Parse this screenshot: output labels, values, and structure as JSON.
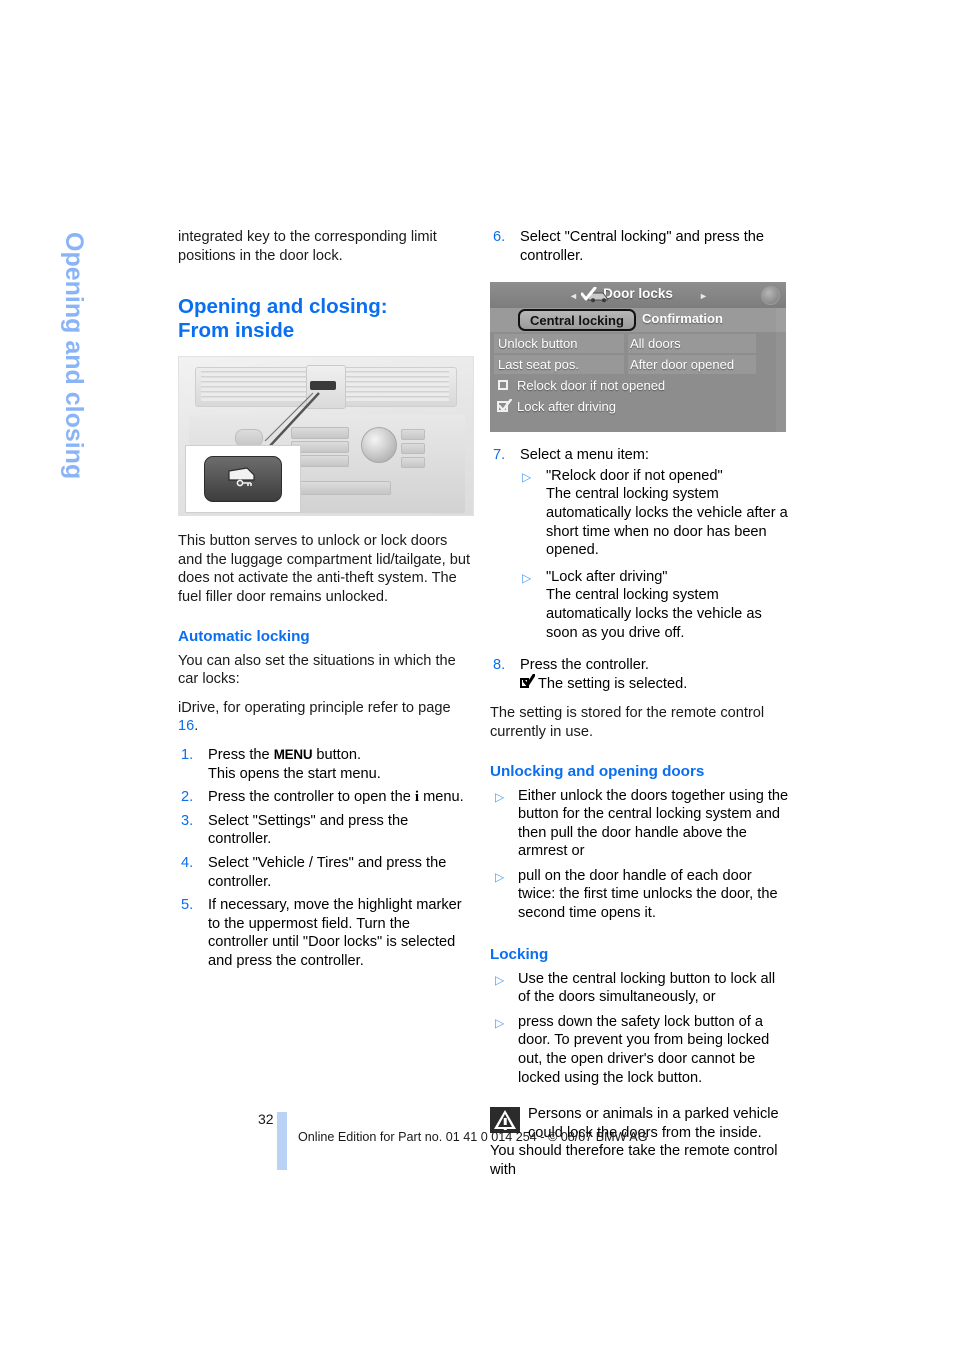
{
  "document": {
    "chapter_tab": "Opening and closing",
    "page_number": "32",
    "footer": "Online Edition for Part no. 01 41 0 014 254 - © 08/07 BMW AG",
    "accent_blue": "#0a6ef0",
    "tab_blue": "#8ab4f8",
    "rule_blue": "#b9d2f5"
  },
  "left_column": {
    "continued_paragraph": "integrated key to the corresponding limit positions in the door lock.",
    "heading": "Opening and closing:\nFrom inside",
    "heading_line1": "Opening and closing:",
    "heading_line2": "From inside",
    "photo_caption_watermark": "",
    "intro_paragraph": "This button serves to unlock or lock doors and the luggage compartment lid/tailgate, but does not activate the anti-theft system. The fuel filler door remains unlocked.",
    "automatic_locking": {
      "heading": "Automatic locking",
      "paragraph": "You can also set the situations in which the car locks:",
      "idrive_note_prefix": "iDrive, for operating principle refer to page ",
      "idrive_note_pageref": "16",
      "idrive_note_suffix": ".",
      "steps": [
        {
          "num": "1.",
          "pre": "Press the ",
          "strong": "MENU",
          "post": " button.",
          "second_line": "This opens the start menu."
        },
        {
          "num": "2.",
          "pre": "Press the controller to open the ",
          "strong": "i",
          "post": " menu.",
          "second_line": ""
        },
        {
          "num": "3.",
          "text": "Select \"Settings\" and press the controller."
        },
        {
          "num": "4.",
          "text": "Select \"Vehicle / Tires\" and press the controller."
        },
        {
          "num": "5.",
          "text": "If necessary, move the highlight marker to the uppermost field. Turn the controller until \"Door locks\" is selected and press the controller."
        }
      ]
    }
  },
  "right_column": {
    "step6": {
      "num": "6.",
      "text": "Select \"Central locking\" and press the controller."
    },
    "idrive_screen": {
      "title": "Door locks",
      "left_arrow": "◄",
      "right_arrow": "►",
      "car_icon": "car-check-icon",
      "corner_icon": "info-badge-icon",
      "tab_selected": "Central locking",
      "tab_unselected": "Confirmation",
      "rows": [
        {
          "label": "Unlock button",
          "value": "All doors"
        },
        {
          "label": "Last seat pos.",
          "value": "After door opened"
        }
      ],
      "checkboxes": [
        {
          "label": "Relock door if not opened",
          "checked": false
        },
        {
          "label": "Lock after driving",
          "checked": true
        }
      ]
    },
    "step7": {
      "num": "7.",
      "text": "Select a menu item:",
      "items": [
        {
          "title": "\"Relock door if not opened\"",
          "body": "The central locking system automatically locks the vehicle after a short time when no door has been opened."
        },
        {
          "title": "\"Lock after driving\"",
          "body": "The central locking system automatically locks the vehicle as soon as you drive off."
        }
      ]
    },
    "step8": {
      "num": "8.",
      "text": "Press the controller.",
      "result": "The setting is selected.",
      "result_icon": "checkbox-checked-icon"
    },
    "stored_paragraph": "The setting is stored for the remote control currently in use.",
    "unlocking_section": {
      "heading": "Unlocking and opening doors",
      "items": [
        "Either unlock the doors together using the button for the central locking system and then pull the door handle above the armrest or",
        "pull on the door handle of each door twice: the first time unlocks the door, the second time opens it."
      ]
    },
    "locking_section": {
      "heading": "Locking",
      "items": [
        "Use the central locking button to lock all of the doors simultaneously, or",
        "press down the safety lock button of a door. To prevent you from being locked out, the open driver's door cannot be locked using the lock button."
      ]
    },
    "warning": {
      "icon": "warning-triangle-icon",
      "text": "Persons or animals in a parked vehicle could lock the doors from the inside. You should therefore take the remote control with"
    }
  }
}
